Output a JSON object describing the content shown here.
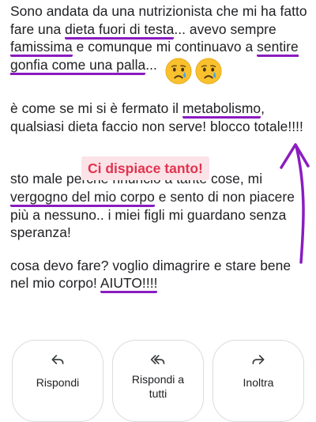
{
  "message": {
    "p1": {
      "a": "Sono andata da una nutrizionista che mi ha fatto fare una ",
      "b": "dieta fuori di testa",
      "c": "... avevo sempre ",
      "d": "famissima",
      "e": " e comunque mi continuavo a ",
      "f": "sentire gonfia come una palla",
      "g": "..."
    },
    "p2": {
      "a": "è come se mi si è fermato il ",
      "b": "metabolismo",
      "c": ", qualsiasi dieta faccio non serve! blocco totale!!!!"
    },
    "p3": {
      "a": "sto male perchè rinuncio a tante cose, mi ",
      "b": "vergogno del mio corpo",
      "c": " e sento di non piacere più a nessuno.. i miei figli mi guardano senza speranza!"
    },
    "p4": {
      "a": "cosa devo fare? voglio dimagrire e stare bene nel mio corpo! ",
      "b": "AIUTO!!!!"
    },
    "emojis": [
      "crying-face-icon",
      "crying-face-icon"
    ]
  },
  "sticker": {
    "text": "Ci dispiace tanto!"
  },
  "actions": {
    "reply": {
      "label": "Rispondi",
      "icon": "reply-icon"
    },
    "reply_all": {
      "label": "Rispondi a tutti",
      "icon": "reply-all-icon"
    },
    "forward": {
      "label": "Inoltra",
      "icon": "forward-icon"
    }
  },
  "colors": {
    "annotation": "#8a1cc0",
    "sticker_text": "#e2334f",
    "sticker_bg": "#fbe3e7"
  }
}
